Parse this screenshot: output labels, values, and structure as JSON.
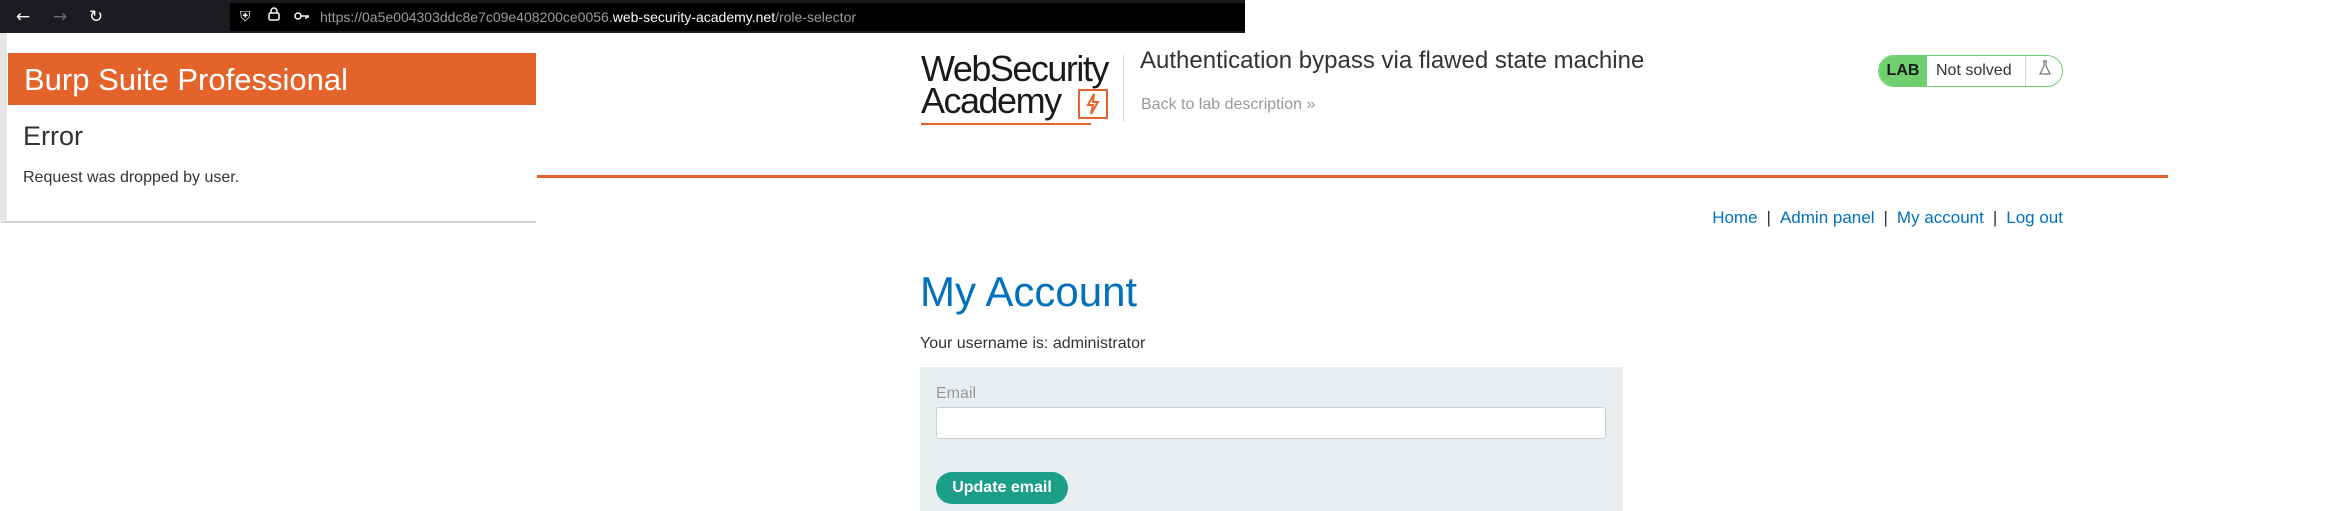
{
  "browser": {
    "back_icon": "arrow-left-icon",
    "forward_icon": "arrow-right-icon",
    "reload_icon": "reload-icon",
    "shield_icon": "shield-icon",
    "lock_icon": "lock-icon",
    "key_icon": "key-icon",
    "url_prefix": "https://0a5e004303ddc8e7c09e408200ce0056.",
    "url_host": "web-security-academy.net",
    "url_path": "/role-selector"
  },
  "burp": {
    "title": "Burp Suite Professional",
    "error_title": "Error",
    "error_message": "Request was dropped by user."
  },
  "header": {
    "logo_line1": "WebSecurity",
    "logo_line2": "Academy",
    "lab_title": "Authentication bypass via flawed state machine",
    "back_link": "Back to lab description",
    "lab_tag": "LAB",
    "lab_status": "Not solved"
  },
  "nav": {
    "home": "Home",
    "admin_panel": "Admin panel",
    "my_account": "My account",
    "log_out": "Log out",
    "separator": "|"
  },
  "main": {
    "heading": "My Account",
    "username_text": "Your username is: administrator",
    "email_label": "Email",
    "email_value": "",
    "update_button": "Update email"
  },
  "colors": {
    "accent_orange": "#e3632a",
    "link_blue": "#0071bc",
    "lab_green": "#70d070",
    "button_teal": "#1a9e87"
  }
}
